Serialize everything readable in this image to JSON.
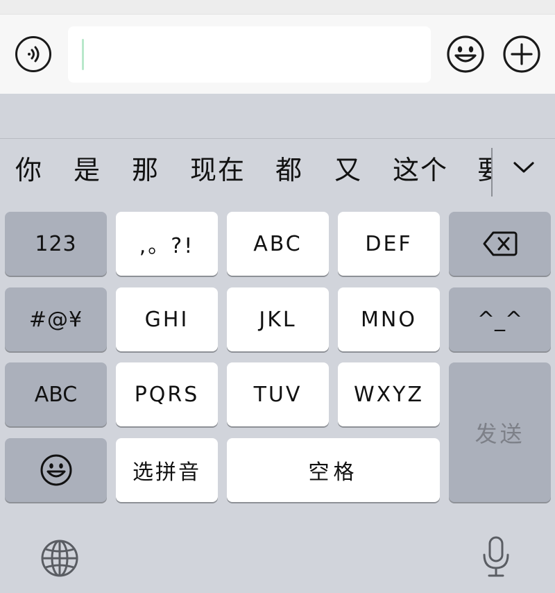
{
  "candidates": [
    "你",
    "是",
    "那",
    "现在",
    "都",
    "又",
    "这个",
    "要"
  ],
  "keys": {
    "num": "123",
    "punct": ",。?!",
    "abc1": "ABC",
    "def": "DEF",
    "symbols": "#@¥",
    "ghi": "GHI",
    "jkl": "JKL",
    "mno": "MNO",
    "kaomoji": "^_^",
    "abc_switch": "ABC",
    "pqrs": "PQRS",
    "tuv": "TUV",
    "wxyz": "WXYZ",
    "send": "发送",
    "select_pinyin": "选拼音",
    "space": "空格"
  },
  "icons": {
    "voice": "voice-wave-icon",
    "emoji": "smiley-icon",
    "plus": "plus-circle-icon",
    "expand": "chevron-down-icon",
    "backspace": "backspace-icon",
    "emoji_key": "smiley-icon",
    "globe": "globe-icon",
    "mic": "microphone-icon"
  },
  "colors": {
    "keyboard_bg": "#d1d4db",
    "light_key": "#ffffff",
    "dark_key": "#abb0bb",
    "caret": "#b8e8cb"
  }
}
